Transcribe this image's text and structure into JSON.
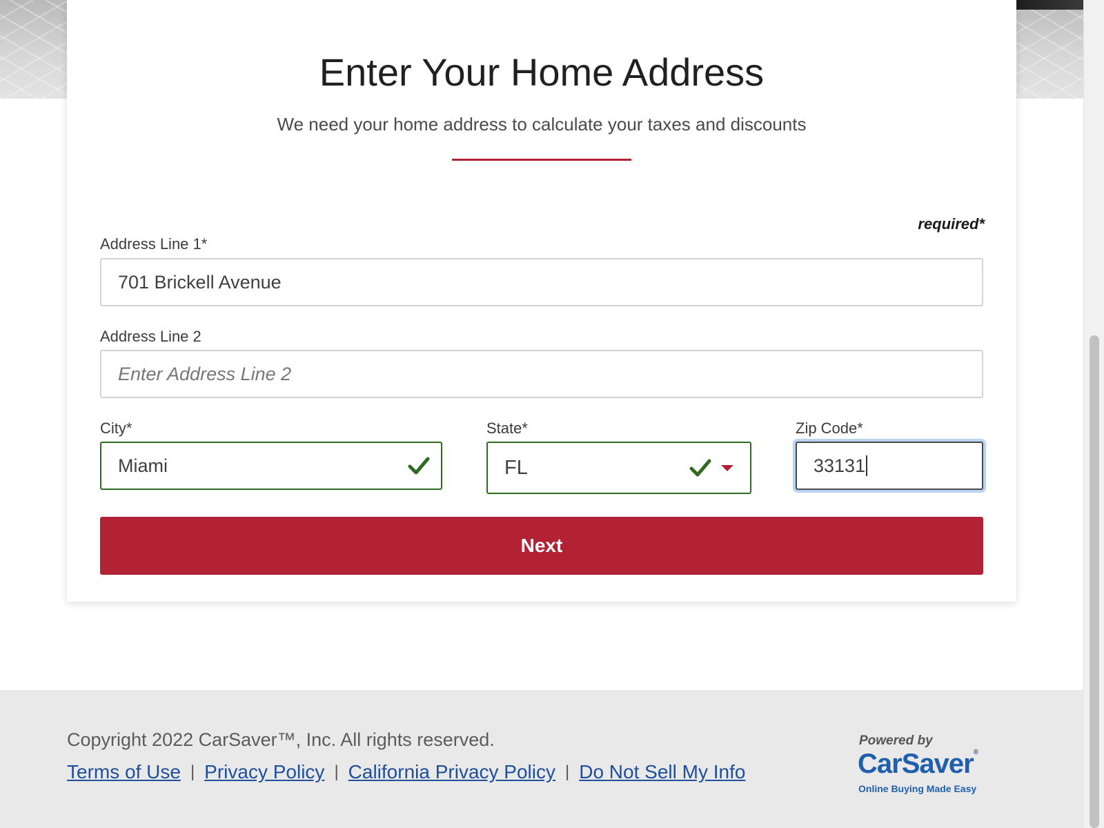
{
  "header": {
    "title": "Enter Your Home Address",
    "subtitle": "We need your home address to calculate your taxes and discounts"
  },
  "form": {
    "required_note": "required*",
    "address1": {
      "label": "Address Line 1*",
      "value": "701 Brickell Avenue"
    },
    "address2": {
      "label": "Address Line 2",
      "placeholder": "Enter Address Line 2",
      "value": ""
    },
    "city": {
      "label": "City*",
      "value": "Miami",
      "valid": true
    },
    "state": {
      "label": "State*",
      "value": "FL",
      "valid": true
    },
    "zip": {
      "label": "Zip Code*",
      "value": "33131",
      "focused": true
    },
    "next_label": "Next"
  },
  "footer": {
    "copyright": "Copyright 2022 CarSaver™, Inc. All rights reserved.",
    "links": [
      "Terms of Use ",
      "Privacy Policy ",
      "California Privacy Policy ",
      "Do Not Sell My Info"
    ],
    "separator": "|",
    "powered_by": "Powered by",
    "brand": "CarSaver",
    "brand_mark": "®",
    "tagline": "Online Buying Made Easy"
  },
  "colors": {
    "accent": "#b22234",
    "valid": "#2f6b1f",
    "link": "#1f4e9a",
    "brand": "#1f5fad"
  }
}
